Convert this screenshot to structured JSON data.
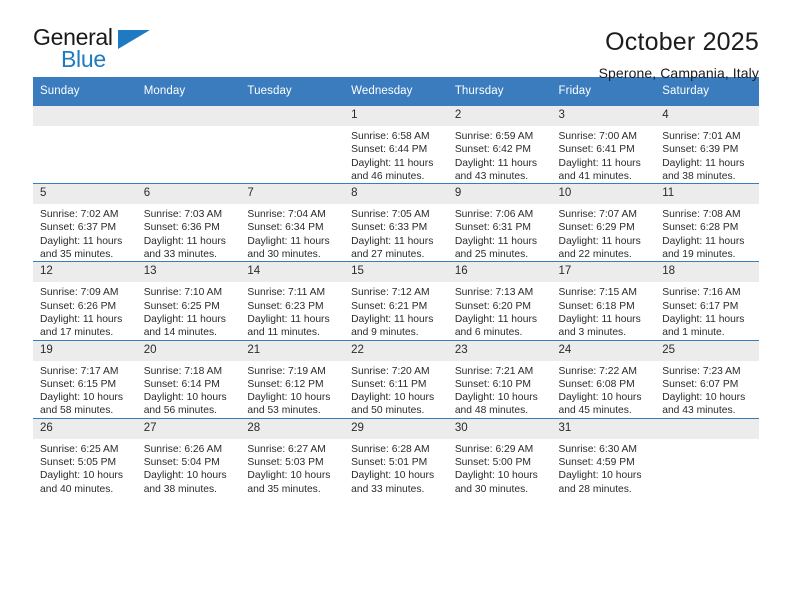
{
  "brand": {
    "name_top": "General",
    "name_bottom": "Blue",
    "accent_color": "#1f7bc1"
  },
  "header": {
    "title": "October 2025",
    "subtitle": "Sperone, Campania, Italy"
  },
  "theme": {
    "header_band_color": "#3a7cbe",
    "date_band_color": "#ececec",
    "text_color": "#2b2b2b"
  },
  "weekdays": [
    "Sunday",
    "Monday",
    "Tuesday",
    "Wednesday",
    "Thursday",
    "Friday",
    "Saturday"
  ],
  "labels": {
    "sunrise": "Sunrise:",
    "sunset": "Sunset:",
    "daylight": "Daylight:"
  },
  "weeks": [
    [
      {
        "day": "",
        "blank": true
      },
      {
        "day": "",
        "blank": true
      },
      {
        "day": "",
        "blank": true
      },
      {
        "day": "1",
        "sunrise": "Sunrise: 6:58 AM",
        "sunset": "Sunset: 6:44 PM",
        "daylight": "Daylight: 11 hours and 46 minutes."
      },
      {
        "day": "2",
        "sunrise": "Sunrise: 6:59 AM",
        "sunset": "Sunset: 6:42 PM",
        "daylight": "Daylight: 11 hours and 43 minutes."
      },
      {
        "day": "3",
        "sunrise": "Sunrise: 7:00 AM",
        "sunset": "Sunset: 6:41 PM",
        "daylight": "Daylight: 11 hours and 41 minutes."
      },
      {
        "day": "4",
        "sunrise": "Sunrise: 7:01 AM",
        "sunset": "Sunset: 6:39 PM",
        "daylight": "Daylight: 11 hours and 38 minutes."
      }
    ],
    [
      {
        "day": "5",
        "sunrise": "Sunrise: 7:02 AM",
        "sunset": "Sunset: 6:37 PM",
        "daylight": "Daylight: 11 hours and 35 minutes."
      },
      {
        "day": "6",
        "sunrise": "Sunrise: 7:03 AM",
        "sunset": "Sunset: 6:36 PM",
        "daylight": "Daylight: 11 hours and 33 minutes."
      },
      {
        "day": "7",
        "sunrise": "Sunrise: 7:04 AM",
        "sunset": "Sunset: 6:34 PM",
        "daylight": "Daylight: 11 hours and 30 minutes."
      },
      {
        "day": "8",
        "sunrise": "Sunrise: 7:05 AM",
        "sunset": "Sunset: 6:33 PM",
        "daylight": "Daylight: 11 hours and 27 minutes."
      },
      {
        "day": "9",
        "sunrise": "Sunrise: 7:06 AM",
        "sunset": "Sunset: 6:31 PM",
        "daylight": "Daylight: 11 hours and 25 minutes."
      },
      {
        "day": "10",
        "sunrise": "Sunrise: 7:07 AM",
        "sunset": "Sunset: 6:29 PM",
        "daylight": "Daylight: 11 hours and 22 minutes."
      },
      {
        "day": "11",
        "sunrise": "Sunrise: 7:08 AM",
        "sunset": "Sunset: 6:28 PM",
        "daylight": "Daylight: 11 hours and 19 minutes."
      }
    ],
    [
      {
        "day": "12",
        "sunrise": "Sunrise: 7:09 AM",
        "sunset": "Sunset: 6:26 PM",
        "daylight": "Daylight: 11 hours and 17 minutes."
      },
      {
        "day": "13",
        "sunrise": "Sunrise: 7:10 AM",
        "sunset": "Sunset: 6:25 PM",
        "daylight": "Daylight: 11 hours and 14 minutes."
      },
      {
        "day": "14",
        "sunrise": "Sunrise: 7:11 AM",
        "sunset": "Sunset: 6:23 PM",
        "daylight": "Daylight: 11 hours and 11 minutes."
      },
      {
        "day": "15",
        "sunrise": "Sunrise: 7:12 AM",
        "sunset": "Sunset: 6:21 PM",
        "daylight": "Daylight: 11 hours and 9 minutes."
      },
      {
        "day": "16",
        "sunrise": "Sunrise: 7:13 AM",
        "sunset": "Sunset: 6:20 PM",
        "daylight": "Daylight: 11 hours and 6 minutes."
      },
      {
        "day": "17",
        "sunrise": "Sunrise: 7:15 AM",
        "sunset": "Sunset: 6:18 PM",
        "daylight": "Daylight: 11 hours and 3 minutes."
      },
      {
        "day": "18",
        "sunrise": "Sunrise: 7:16 AM",
        "sunset": "Sunset: 6:17 PM",
        "daylight": "Daylight: 11 hours and 1 minute."
      }
    ],
    [
      {
        "day": "19",
        "sunrise": "Sunrise: 7:17 AM",
        "sunset": "Sunset: 6:15 PM",
        "daylight": "Daylight: 10 hours and 58 minutes."
      },
      {
        "day": "20",
        "sunrise": "Sunrise: 7:18 AM",
        "sunset": "Sunset: 6:14 PM",
        "daylight": "Daylight: 10 hours and 56 minutes."
      },
      {
        "day": "21",
        "sunrise": "Sunrise: 7:19 AM",
        "sunset": "Sunset: 6:12 PM",
        "daylight": "Daylight: 10 hours and 53 minutes."
      },
      {
        "day": "22",
        "sunrise": "Sunrise: 7:20 AM",
        "sunset": "Sunset: 6:11 PM",
        "daylight": "Daylight: 10 hours and 50 minutes."
      },
      {
        "day": "23",
        "sunrise": "Sunrise: 7:21 AM",
        "sunset": "Sunset: 6:10 PM",
        "daylight": "Daylight: 10 hours and 48 minutes."
      },
      {
        "day": "24",
        "sunrise": "Sunrise: 7:22 AM",
        "sunset": "Sunset: 6:08 PM",
        "daylight": "Daylight: 10 hours and 45 minutes."
      },
      {
        "day": "25",
        "sunrise": "Sunrise: 7:23 AM",
        "sunset": "Sunset: 6:07 PM",
        "daylight": "Daylight: 10 hours and 43 minutes."
      }
    ],
    [
      {
        "day": "26",
        "sunrise": "Sunrise: 6:25 AM",
        "sunset": "Sunset: 5:05 PM",
        "daylight": "Daylight: 10 hours and 40 minutes."
      },
      {
        "day": "27",
        "sunrise": "Sunrise: 6:26 AM",
        "sunset": "Sunset: 5:04 PM",
        "daylight": "Daylight: 10 hours and 38 minutes."
      },
      {
        "day": "28",
        "sunrise": "Sunrise: 6:27 AM",
        "sunset": "Sunset: 5:03 PM",
        "daylight": "Daylight: 10 hours and 35 minutes."
      },
      {
        "day": "29",
        "sunrise": "Sunrise: 6:28 AM",
        "sunset": "Sunset: 5:01 PM",
        "daylight": "Daylight: 10 hours and 33 minutes."
      },
      {
        "day": "30",
        "sunrise": "Sunrise: 6:29 AM",
        "sunset": "Sunset: 5:00 PM",
        "daylight": "Daylight: 10 hours and 30 minutes."
      },
      {
        "day": "31",
        "sunrise": "Sunrise: 6:30 AM",
        "sunset": "Sunset: 4:59 PM",
        "daylight": "Daylight: 10 hours and 28 minutes."
      },
      {
        "day": "",
        "blank": true
      }
    ]
  ]
}
